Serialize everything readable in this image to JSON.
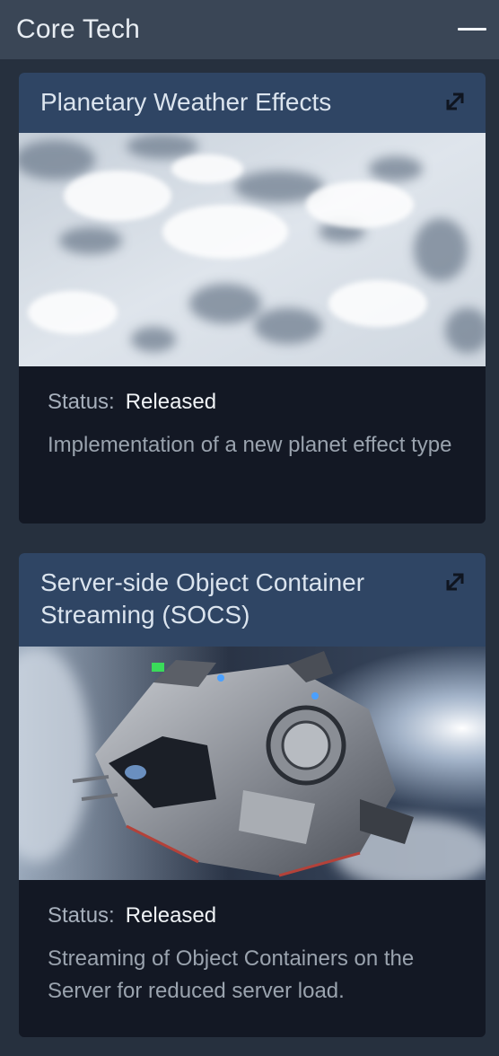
{
  "panel": {
    "title": "Core Tech",
    "collapse_icon": "minus-icon"
  },
  "cards": [
    {
      "title": "Planetary Weather Effects",
      "link_icon": "external-link-icon",
      "image": "cloud-layer-aerial-image",
      "status_label": "Status:",
      "status_value": "Released",
      "description": "Implementation of a new planet effect type"
    },
    {
      "title": "Server-side Object Container Streaming (SOCS)",
      "link_icon": "external-link-icon",
      "image": "spaceship-over-planet-image",
      "status_label": "Status:",
      "status_value": "Released",
      "description": "Streaming of Object Containers on the Server for reduced server load."
    }
  ],
  "colors": {
    "background": "#26303e",
    "header": "#3a4656",
    "card_header": "#2f4564",
    "card_body": "#131824"
  }
}
